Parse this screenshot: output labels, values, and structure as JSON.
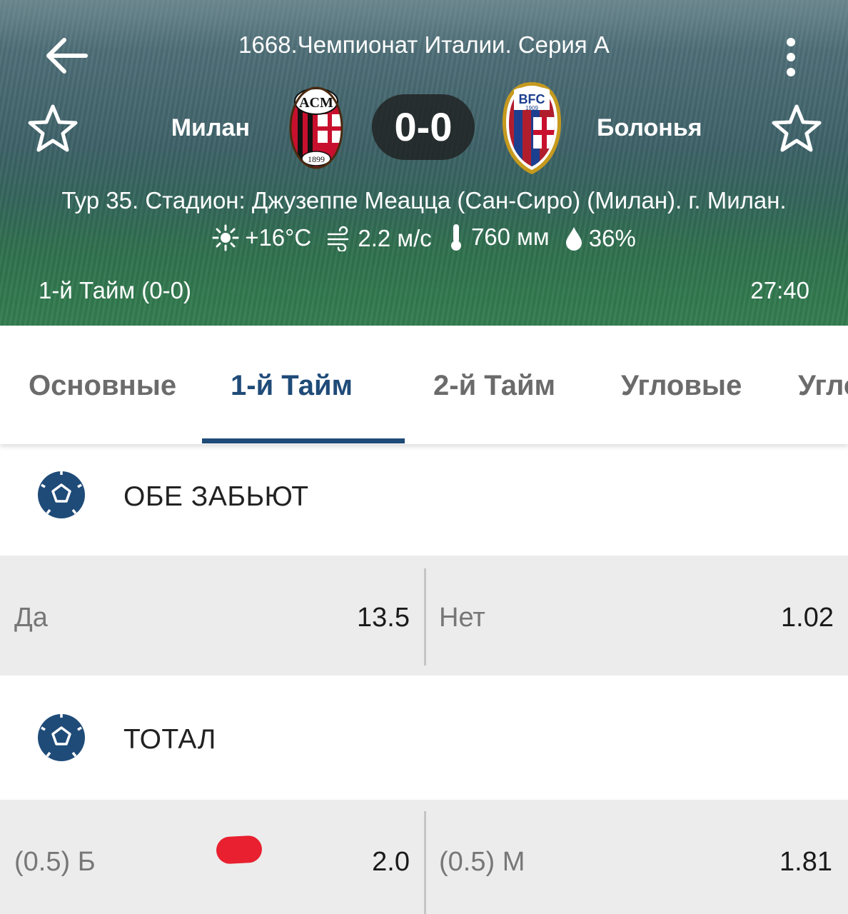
{
  "header": {
    "league": "1668.Чемпионат Италии. Серия А",
    "home_team": "Милан",
    "away_team": "Болонья",
    "score": "0-0",
    "venue": "Тур 35. Стадион: Джузеппе Меацца (Сан-Сиро) (Милан). г. Милан.",
    "weather": {
      "temperature": "+16°C",
      "wind": "2.2 м/с",
      "pressure": "760 мм",
      "humidity": "36%"
    },
    "period": "1-й  Тайм (0-0)",
    "timer": "27:40",
    "icons": {
      "back": "arrow-left-icon",
      "menu": "more-vertical-icon",
      "favorite": "star-outline-icon",
      "sun": "sun-icon",
      "wind": "wind-icon",
      "thermometer": "thermometer-icon",
      "drop": "drop-icon"
    },
    "home_logo_text": {
      "top": "ACM",
      "bottom": "1899"
    },
    "away_logo_text": {
      "top": "BFC",
      "year": "1909"
    }
  },
  "tabs": [
    {
      "label": "Основные",
      "active": false
    },
    {
      "label": "1-й  Тайм",
      "active": true
    },
    {
      "label": "2-й  Тайм",
      "active": false
    },
    {
      "label": "Угловые",
      "active": false
    },
    {
      "label": "Угловые",
      "active": false
    }
  ],
  "markets": [
    {
      "title": "ОБЕ ЗАБЬЮТ",
      "icon": "soccer-ball-icon",
      "outcomes": [
        {
          "label": "Да",
          "odds": "13.5"
        },
        {
          "label": "Нет",
          "odds": "1.02"
        }
      ]
    },
    {
      "title": "ТОТАЛ",
      "icon": "soccer-ball-icon",
      "outcomes": [
        {
          "label": "(0.5) Б",
          "odds": "2.0"
        },
        {
          "label": "(0.5) М",
          "odds": "1.81"
        }
      ]
    }
  ],
  "colors": {
    "accent": "#1f4b78",
    "tab_inactive": "#6b6b6b",
    "odds_row_bg": "#ececec",
    "change_marker": "#e8202f"
  }
}
